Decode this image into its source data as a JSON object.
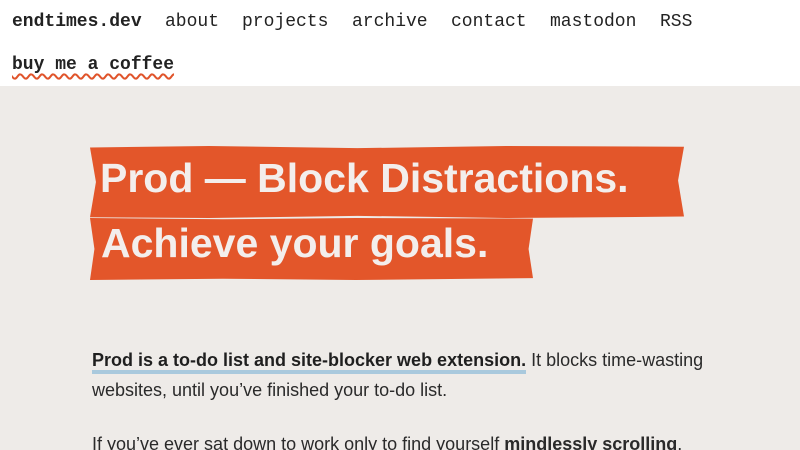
{
  "nav": {
    "brand": "endtimes.dev",
    "links": [
      "about",
      "projects",
      "archive",
      "contact",
      "mastodon",
      "RSS"
    ],
    "coffee": "buy me a coffee"
  },
  "colors": {
    "accent": "#e3562a",
    "page_background": "#eeebe8",
    "link_underline": "#a9c9dd"
  },
  "hero": {
    "line1": "Prod — Block Distractions.",
    "line2": "Achieve your goals."
  },
  "content": {
    "para1_link": "Prod is a to-do list and site-blocker web extension.",
    "para1_rest": " It blocks time-wasting websites, until you’ve finished your to-do list.",
    "para2_start": "If you’ve ever sat down to work only to find yourself ",
    "para2_bold": "mindlessly scrolling",
    "para2_end": "."
  }
}
